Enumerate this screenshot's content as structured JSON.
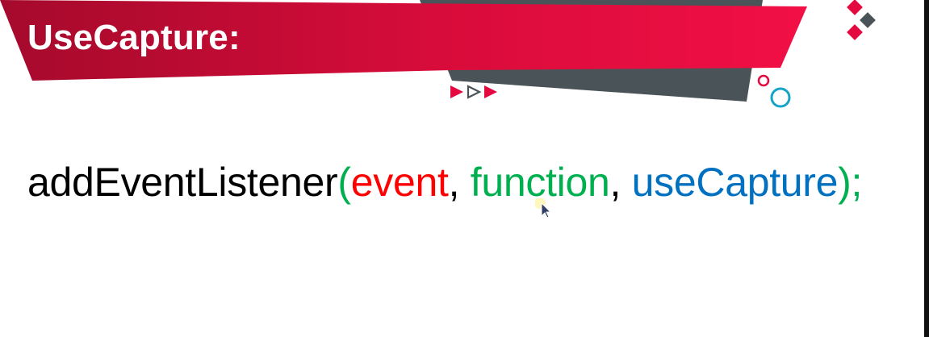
{
  "slide": {
    "title": "UseCapture:"
  },
  "code": {
    "function_name": "addEventListener",
    "open_paren": "(",
    "param1": "event",
    "sep1": ",",
    "param2": "function",
    "sep2": ",",
    "param3": "useCapture",
    "close": ");"
  },
  "colors": {
    "banner_red": "#e4093f",
    "banner_dark_red": "#a50a2c",
    "shape_gray": "#4a5358",
    "accent_teal": "#16a4c8",
    "accent_pink": "#e4093f",
    "code_green": "#00b050",
    "code_red": "#ff0000",
    "code_blue": "#0070c0"
  },
  "icons": {
    "arrows": "play-arrows-icon",
    "diamonds": "diamond-cluster-icon",
    "circles": "ring-circles-icon",
    "cursor": "mouse-pointer-icon"
  }
}
